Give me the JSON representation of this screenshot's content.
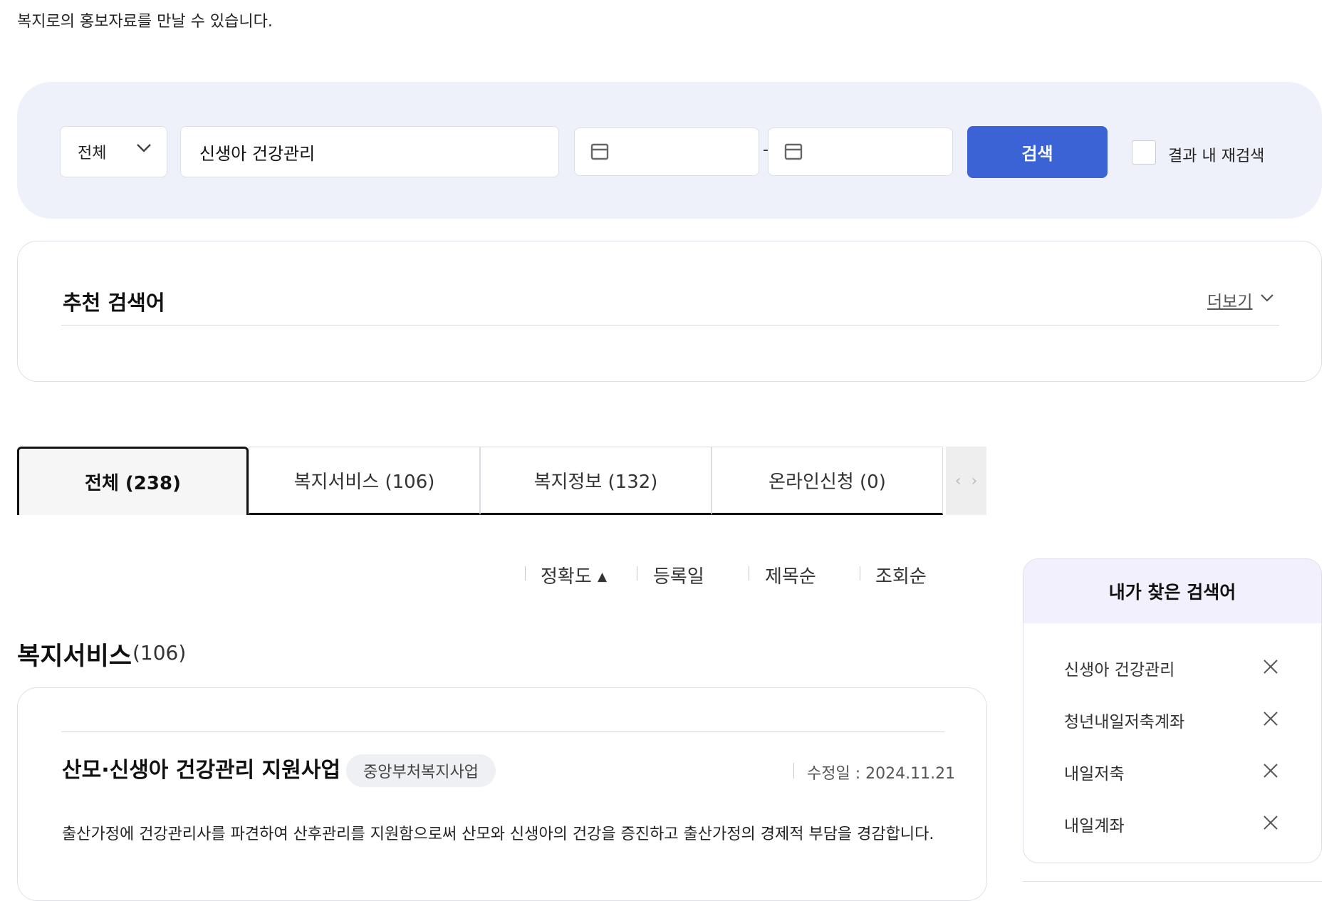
{
  "intro_text": "복지로의 홍보자료를 만날 수 있습니다.",
  "search": {
    "scope_selected": "전체",
    "keyword_value": "신생아 건강관리",
    "date_separator": "-",
    "search_button": "검색",
    "research_label": "결과 내 재검색"
  },
  "recommended": {
    "title": "추천 검색어",
    "more_label": "더보기"
  },
  "tabs": [
    {
      "label": "전체  (238)",
      "active": true
    },
    {
      "label": "복지서비스 (106)",
      "active": false
    },
    {
      "label": "복지정보 (132)",
      "active": false
    },
    {
      "label": "온라인신청 (0)",
      "active": false
    }
  ],
  "sort": [
    {
      "label": "정확도",
      "active": true
    },
    {
      "label": "등록일"
    },
    {
      "label": "제목순"
    },
    {
      "label": "조회순"
    }
  ],
  "section": {
    "title": "복지서비스",
    "count": "(106)"
  },
  "result": {
    "title": "산모·신생아 건강관리 지원사업",
    "badge": "중앙부처복지사업",
    "modified": "수정일 : 2024.11.21",
    "description": "출산가정에 건강관리사를 파견하여 산후관리를 지원함으로써 산모와 신생아의 건강을 증진하고 출산가정의 경제적 부담을 경감합니다."
  },
  "my_searches": {
    "title": "내가 찾은 검색어",
    "items": [
      "신생아 건강관리",
      "청년내일저축계좌",
      "내일저축",
      "내일계좌"
    ]
  }
}
